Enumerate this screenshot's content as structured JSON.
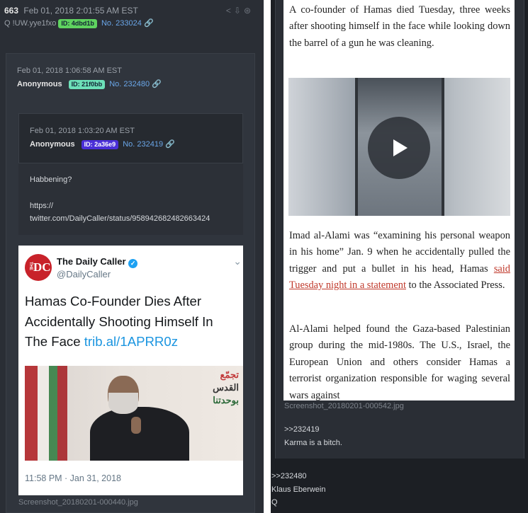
{
  "q_post": {
    "number": "663",
    "date": "Feb 01, 2018 2:01:55 AM EST",
    "tripcode": "Q !UW.yye1fxo",
    "id_badge": "ID: 4dbd1b",
    "post_no": "No. 233024",
    "colors": {
      "id_bg": "#5fd35f"
    }
  },
  "post_232480": {
    "date": "Feb 01, 2018 1:06:58 AM EST",
    "name": "Anonymous",
    "id_badge": "ID: 21f0bb",
    "post_no": "No. 232480",
    "colors": {
      "id_bg": "#6de0b8"
    }
  },
  "post_232419": {
    "date": "Feb 01, 2018 1:03:20 AM EST",
    "name": "Anonymous",
    "id_badge": "ID: 2a36e9",
    "post_no": "No. 232419",
    "body_line1": "Habbening?",
    "body_line2": "https://",
    "body_line3": "twitter.com/DailyCaller/status/958942682482663424",
    "colors": {
      "id_bg": "#4a2fd8"
    }
  },
  "tweet": {
    "account_name": "The Daily Caller",
    "handle": "@DailyCaller",
    "logo_text": "DC",
    "logo_small": "THE",
    "headline_part": "Hamas Co-Founder Dies After Accidentally Shooting Himself In The Face",
    "link": "trib.al/1APRR0z",
    "timestamp": "11:58 PM · Jan 31, 2018",
    "arabic_line1": "تجمّع",
    "arabic_line2": "القدس",
    "arabic_line3": "بوحدتنا"
  },
  "left_filename": "Screenshot_20180201-000440.jpg",
  "article": {
    "p1": "A co-founder of Hamas died Tuesday, three weeks after shooting himself in the face while looking down the barrel of a gun he was cleaning.",
    "p2_a": "Imad al-Alami was “examining his personal weapon in his home” Jan. 9 when he accidentally pulled the trigger and put a bullet in his head, Hamas ",
    "p2_link": "said Tuesday night in a statement",
    "p2_b": " to the Associated Press.",
    "p3": "Al-Alami helped found the Gaza-based Palestinian group during the mid-1980s. The U.S., Israel, the European Union and others consider Hamas a terrorist organization responsible for waging several wars against"
  },
  "right_filename": "Screenshot_20180201-000542.jpg",
  "reply": {
    "quote": ">>232419",
    "text": "Karma is a bitch."
  },
  "q_reply": {
    "quote": ">>232480",
    "line1": "Klaus Eberwein",
    "line2": "Q"
  }
}
